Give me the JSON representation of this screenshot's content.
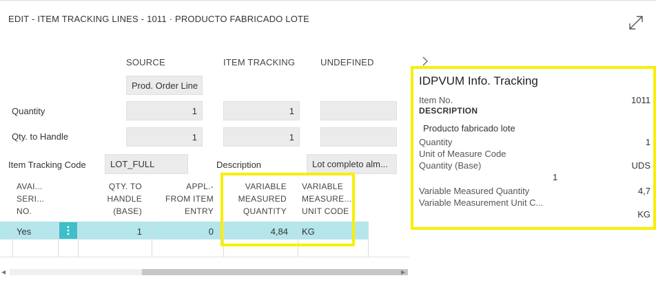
{
  "page": {
    "title": "EDIT - ITEM TRACKING LINES - 1011 · PRODUCTO FABRICADO LOTE"
  },
  "header": {
    "columns": {
      "source": "SOURCE",
      "item_tracking": "ITEM TRACKING",
      "undefined": "UNDEFINED"
    },
    "source_type": "Prod. Order Line",
    "quantity": {
      "label": "Quantity",
      "source": "1",
      "item_tracking": "1",
      "undefined": ""
    },
    "qty_to_handle": {
      "label": "Qty. to Handle",
      "source": "1",
      "item_tracking": "1",
      "undefined": ""
    },
    "item_tracking_code": {
      "label": "Item Tracking Code",
      "value": "LOT_FULL"
    },
    "description": {
      "label": "Description",
      "value": "Lot completo alm..."
    }
  },
  "grid": {
    "columns": {
      "avail": [
        "AVAI...",
        "SERI...",
        "NO."
      ],
      "qty_to_handle": [
        "QTY. TO",
        "HANDLE",
        "(BASE)"
      ],
      "appl_from": [
        "APPL.-",
        "FROM ITEM",
        "ENTRY"
      ],
      "var_qty": [
        "VARIABLE",
        "MEASURED",
        "QUANTITY"
      ],
      "var_unit": [
        "VARIABLE",
        "MEASURE...",
        "UNIT CODE"
      ]
    },
    "rows": [
      {
        "avail": "Yes",
        "qty_to_handle": "1",
        "appl_from": "0",
        "var_qty": "4,84",
        "var_unit": "KG"
      }
    ]
  },
  "factbox": {
    "title": "IDPVUM Info. Tracking",
    "item_no_label": "Item No.",
    "item_no": "1011",
    "description_heading": "DESCRIPTION",
    "description": "Producto fabricado lote",
    "quantity_label": "Quantity",
    "quantity": "1",
    "uom_label": "Unit of Measure Code",
    "qty_base_label": "Quantity (Base)",
    "uom": "UDS",
    "qty_base": "1",
    "var_qty_label": "Variable Measured Quantity",
    "var_qty": "4,7",
    "var_unit_label": "Variable Measurement Unit C...",
    "var_unit": "KG"
  },
  "colors": {
    "highlight": "#f7ef05",
    "selected_row": "#b4e5ea",
    "action_button": "#3fbec9"
  }
}
